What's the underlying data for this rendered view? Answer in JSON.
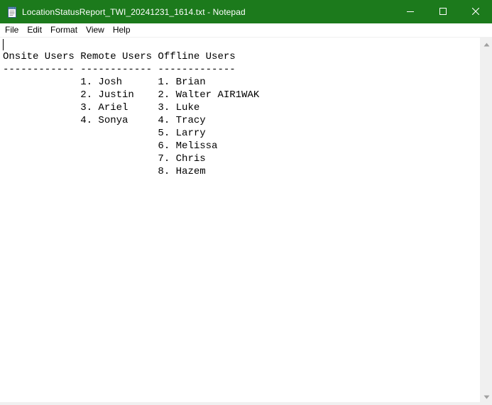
{
  "window": {
    "title": "LocationStatusReport_TWI_20241231_1614.txt - Notepad",
    "titlebar_color": "#1c7a1c",
    "controls": [
      "minimize-icon",
      "maximize-icon",
      "close-icon"
    ]
  },
  "menu": {
    "items": [
      "File",
      "Edit",
      "Format",
      "View",
      "Help"
    ]
  },
  "editor": {
    "lines": [
      "",
      "Onsite Users Remote Users Offline Users",
      "------------ ------------ -------------",
      "             1. Josh      1. Brian",
      "             2. Justin    2. Walter AIR1WAK",
      "             3. Ariel     3. Luke",
      "             4. Sonya     4. Tracy",
      "                          5. Larry",
      "                          6. Melissa",
      "                          7. Chris",
      "                          8. Hazem"
    ]
  }
}
